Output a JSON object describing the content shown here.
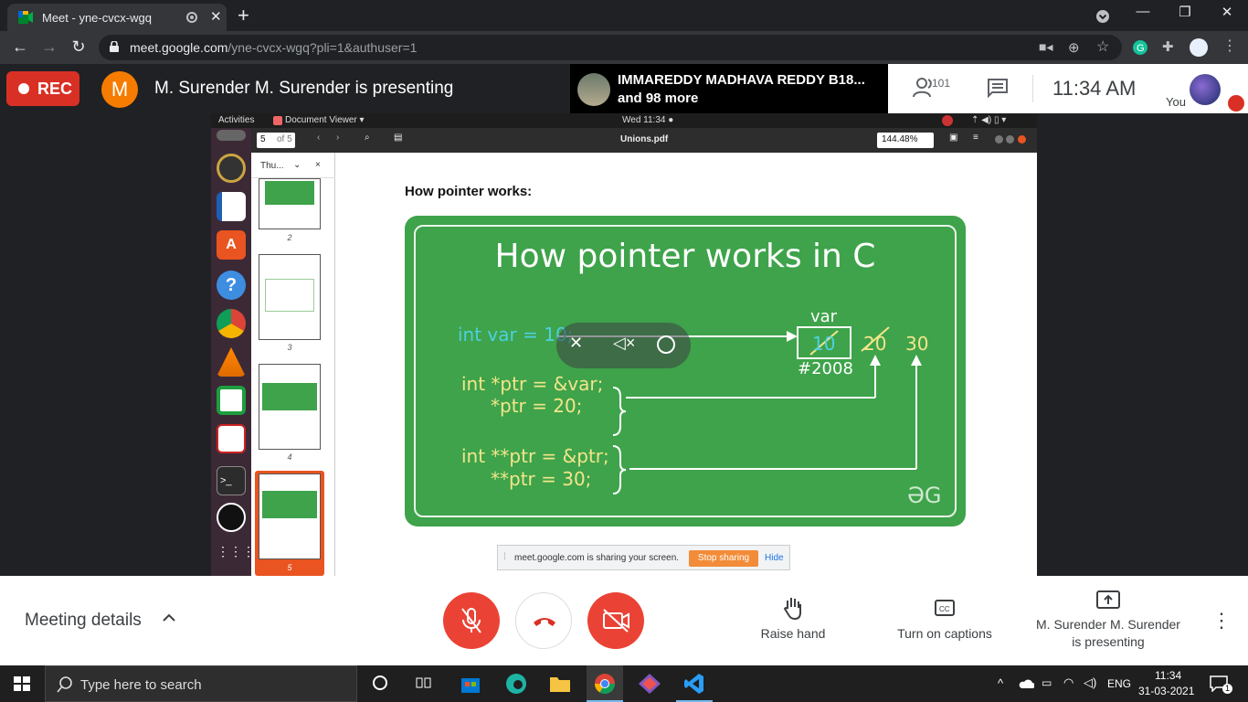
{
  "browser": {
    "tab_title": "Meet - yne-cvcx-wgq",
    "url_host": "meet.google.com",
    "url_path": "/yne-cvcx-wgq?pli=1&authuser=1"
  },
  "meet_top": {
    "rec_label": "REC",
    "presenter_initial": "M",
    "presenting_text": "M. Surender M. Surender is presenting",
    "tile_name_line1": "IMMAREDDY MADHAVA REDDY B18...",
    "tile_name_line2": "and 98 more",
    "participants_count": "101",
    "time": "11:34  AM",
    "you_label": "You"
  },
  "ubuntu": {
    "activities": "Activities",
    "app_menu": "Document Viewer ▾",
    "clock": "Wed 11:34 ●",
    "page_input": "5",
    "page_of": "of 5",
    "doc_title": "Unions.pdf",
    "zoom": "144.48%",
    "sidebar_tab": "Thu...",
    "thumb_numbers": [
      "2",
      "3",
      "4",
      "5"
    ]
  },
  "pdf": {
    "heading": "How pointer works:",
    "figure_title": "How pointer works in C",
    "line_var": "int var = 10;",
    "line_ptr1": "int *ptr = &var;",
    "line_ptr2": "*ptr = 20;",
    "line_pp1": "int **ptr = &ptr;",
    "line_pp2": "**ptr = 30;",
    "box_label": "var",
    "box_value": "10",
    "address": "#2008",
    "value_20": "20",
    "value_30": "30",
    "logo": "ƏG"
  },
  "share_bar": {
    "message": "meet.google.com is sharing your screen.",
    "stop_label": "Stop sharing",
    "hide_label": "Hide"
  },
  "meet_bottom": {
    "meeting_details": "Meeting details",
    "raise_hand": "Raise hand",
    "captions": "Turn on captions",
    "presenting_line1": "M. Surender M. Surender",
    "presenting_line2": "is presenting"
  },
  "taskbar": {
    "search_placeholder": "Type here to search",
    "language": "ENG",
    "time": "11:34",
    "date": "31-03-2021",
    "notification_count": "1"
  },
  "colors": {
    "rec_red": "#d93025",
    "meet_dark": "#202124",
    "gfg_green": "#3ea34a",
    "code_cyan": "#4dd0e1",
    "code_yellow": "#f3e58b",
    "stop_orange": "#f28c38"
  }
}
